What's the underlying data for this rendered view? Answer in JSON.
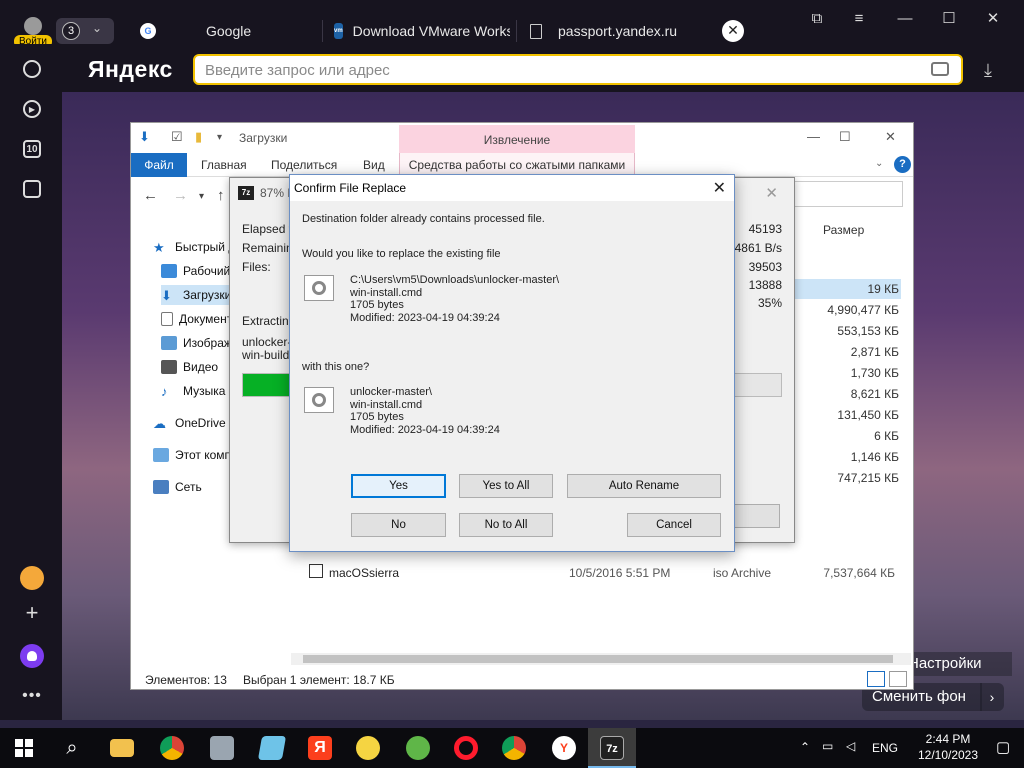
{
  "browser": {
    "login_label": "Войти",
    "tab_count": "3",
    "tabs": [
      {
        "label": "Google",
        "icon": "google-favicon"
      },
      {
        "label": "Download VMware Works",
        "icon": "vmware-favicon"
      },
      {
        "label": "passport.yandex.ru",
        "icon": "page-icon"
      }
    ],
    "logo": "Яндекс",
    "address_placeholder": "Введите запрос или адрес",
    "sidebar_badge": "10"
  },
  "wallpaper": {
    "settings_label": "Настройки",
    "change_bg_label": "Сменить фон"
  },
  "explorer": {
    "title": "Загрузки",
    "context_tab": "Извлечение",
    "ribbon": {
      "file": "Файл",
      "home": "Главная",
      "share": "Поделиться",
      "view": "Вид",
      "context": "Средства работы со сжатыми папками"
    },
    "nav": [
      {
        "label": "Быстрый доступ"
      },
      {
        "label": "Рабочий стол"
      },
      {
        "label": "Загрузки"
      },
      {
        "label": "Документы"
      },
      {
        "label": "Изображения"
      },
      {
        "label": "Видео"
      },
      {
        "label": "Музыка"
      },
      {
        "label": "OneDrive"
      },
      {
        "label": "Этот компьютер"
      },
      {
        "label": "Сеть"
      }
    ],
    "size_header": "Размер",
    "sizes": [
      "19 КБ",
      "4,990,477 КБ",
      "553,153 КБ",
      "2,871 КБ",
      "1,730 КБ",
      "8,621 КБ",
      "131,450 КБ",
      "6 КБ",
      "1,146 КБ",
      "747,215 КБ"
    ],
    "visible_file": {
      "name": "macOSsierra",
      "date": "10/5/2016 5:51 PM",
      "type": "iso Archive",
      "size": "7,537,664 КБ"
    },
    "status_items": "Элементов: 13",
    "status_selected": "Выбран 1 элемент: 18.7 КБ"
  },
  "progress": {
    "title": "87% Extracting",
    "labels": {
      "elapsed": "Elapsed time:",
      "remaining": "Remaining time:",
      "files": "Files:",
      "extracting": "Extracting"
    },
    "values": {
      "elapsed": "45193",
      "speed": "4861 B/s",
      "files": "39503",
      "count": "13888",
      "percent": "35%"
    },
    "path_line1": "unlocker-master",
    "path_line2": "win-build.cmd",
    "progress_fraction": 0.87
  },
  "dialog": {
    "title": "Confirm File Replace",
    "line1": "Destination folder already contains processed file.",
    "line2": "Would you like to replace the existing file",
    "existing": {
      "path": "C:\\Users\\vm5\\Downloads\\unlocker-master\\",
      "name": "win-install.cmd",
      "size": "1705 bytes",
      "modified": "Modified: 2023-04-19 04:39:24"
    },
    "with_label": "with this one?",
    "incoming": {
      "path": "unlocker-master\\",
      "name": "win-install.cmd",
      "size": "1705 bytes",
      "modified": "Modified: 2023-04-19 04:39:24"
    },
    "buttons": {
      "yes": "Yes",
      "yes_all": "Yes to All",
      "auto_rename": "Auto Rename",
      "no": "No",
      "no_all": "No to All",
      "cancel": "Cancel"
    }
  },
  "taskbar": {
    "lang": "ENG",
    "time": "2:44 PM",
    "date": "12/10/2023",
    "active_app": "7z"
  },
  "colors": {
    "accent_yellow": "#f2c200",
    "explorer_blue": "#1a6dc2",
    "progress_green": "#06b025",
    "focus_blue": "#0078d7"
  }
}
